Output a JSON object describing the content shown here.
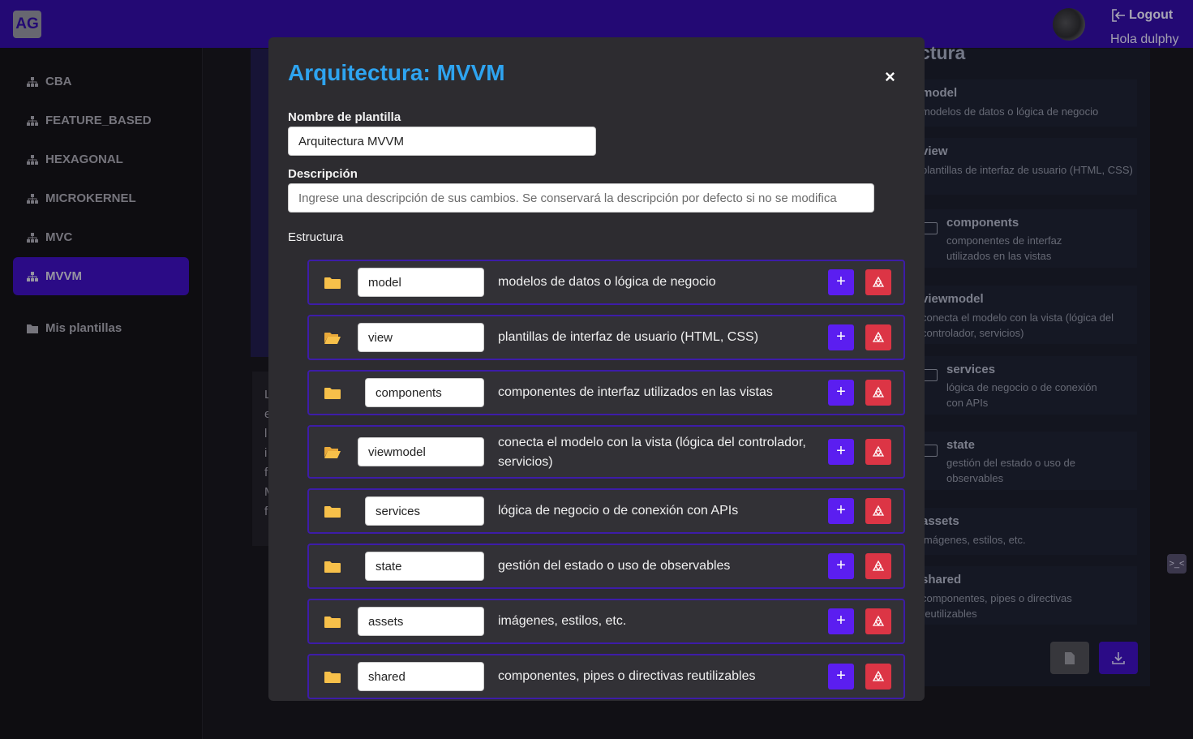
{
  "app": {
    "logo": "AG",
    "logout": "Logout",
    "greeting": "Hola dulphy"
  },
  "sidebar": {
    "items": [
      {
        "label": "CBA"
      },
      {
        "label": "FEATURE_BASED"
      },
      {
        "label": "HEXAGONAL"
      },
      {
        "label": "MICROKERNEL"
      },
      {
        "label": "MVC"
      },
      {
        "label": "MVVM",
        "active": true
      }
    ],
    "my_templates": "Mis plantillas"
  },
  "background": {
    "letters": [
      "L",
      "e",
      "l",
      "i",
      "f",
      "M",
      "f"
    ],
    "panel_title": "uctura",
    "panel_items": [
      {
        "name": "model",
        "desc": "modelos de datos o lógica de negocio"
      },
      {
        "name": "view",
        "desc": "plantillas de interfaz de usuario (HTML, CSS)"
      },
      {
        "name": "components",
        "desc": "componentes de interfaz utilizados en las vistas"
      },
      {
        "name": "viewmodel",
        "desc": "conecta el modelo con la vista (lógica del controlador, servicios)"
      },
      {
        "name": "services",
        "desc": "lógica de negocio o de conexión con APIs"
      },
      {
        "name": "state",
        "desc": "gestión del estado o uso de observables"
      },
      {
        "name": "assets",
        "desc": "imágenes, estilos, etc."
      },
      {
        "name": "shared",
        "desc": "componentes, pipes o directivas reutilizables"
      }
    ]
  },
  "modal": {
    "title": "Arquitectura: MVVM",
    "close": "×",
    "name_label": "Nombre de plantilla",
    "name_value": "Arquitectura MVVM",
    "desc_label": "Descripción",
    "desc_placeholder": "Ingrese una descripción de sus cambios. Se conservará la descripción por defecto si no se modifica",
    "structure_label": "Estructura",
    "add_label": "+",
    "rows": [
      {
        "name": "model",
        "desc": "modelos de datos o lógica de negocio"
      },
      {
        "name": "view",
        "desc": "plantillas de interfaz de usuario (HTML, CSS)"
      },
      {
        "name": "components",
        "desc": "componentes de interfaz utilizados en las vistas"
      },
      {
        "name": "viewmodel",
        "desc": "conecta el modelo con la vista (lógica del controlador, servicios)"
      },
      {
        "name": "services",
        "desc": "lógica de negocio o de conexión con APIs"
      },
      {
        "name": "state",
        "desc": "gestión del estado o uso de observables"
      },
      {
        "name": "assets",
        "desc": "imágenes, estilos, etc."
      },
      {
        "name": "shared",
        "desc": "componentes, pipes o directivas reutilizables"
      }
    ]
  },
  "colors": {
    "accent": "#3a0fb3",
    "title": "#2ea4f0",
    "add": "#5b1ef0",
    "delete": "#dc3545",
    "folder": "#f7c04a"
  }
}
